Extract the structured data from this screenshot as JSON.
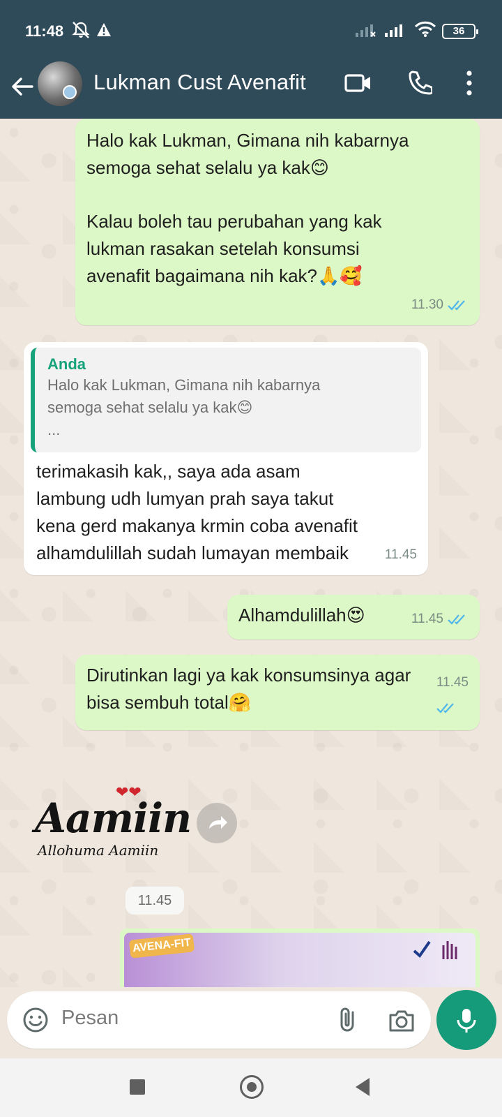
{
  "status_bar": {
    "time": "11:48",
    "battery": "36"
  },
  "header": {
    "contact_name": "Lukman Cust Avenafit"
  },
  "messages": [
    {
      "direction": "outgoing",
      "lines": [
        "Halo kak Lukman, Gimana nih kabarnya",
        "semoga sehat selalu ya kak😊",
        "",
        "Kalau boleh tau perubahan yang kak",
        "lukman rasakan setelah konsumsi",
        "avenafit bagaimana nih kak?🙏🥰"
      ],
      "time": "11.30",
      "status": "read"
    },
    {
      "direction": "incoming",
      "reply_to": {
        "author": "Anda",
        "lines": [
          "Halo kak Lukman, Gimana nih kabarnya",
          "semoga sehat selalu ya kak😊",
          "..."
        ]
      },
      "lines": [
        "terimakasih kak,, saya ada asam",
        "lambung udh lumyan prah saya takut",
        "kena gerd makanya krmin coba avenafit",
        "alhamdulillah sudah lumayan membaik"
      ],
      "time": "11.45"
    },
    {
      "direction": "outgoing",
      "text": "Alhamdulillah😍",
      "time": "11.45",
      "status": "read"
    },
    {
      "direction": "outgoing",
      "lines": [
        "Dirutinkan lagi ya kak konsumsinya agar",
        "bisa sembuh total🤗"
      ],
      "time": "11.45",
      "status": "read"
    }
  ],
  "sticker": {
    "text_main": "Aamiin",
    "text_sub": "Allohuma Aamiin",
    "time": "11.45"
  },
  "image_preview": {
    "brand_text": "AVENA-FIT"
  },
  "composer": {
    "placeholder": "Pesan"
  },
  "icons": {
    "back": "arrow-left-icon",
    "video": "video-call-icon",
    "call": "phone-icon",
    "menu": "more-vert-icon",
    "emoji": "emoji-icon",
    "attach": "paperclip-icon",
    "camera": "camera-icon",
    "mic": "mic-icon"
  },
  "colors": {
    "header": "#2f4a58",
    "outgoing_bubble": "#dcf8c6",
    "incoming_bubble": "#ffffff",
    "accent_green": "#159b7a",
    "read_ticks": "#4fb6ec"
  }
}
